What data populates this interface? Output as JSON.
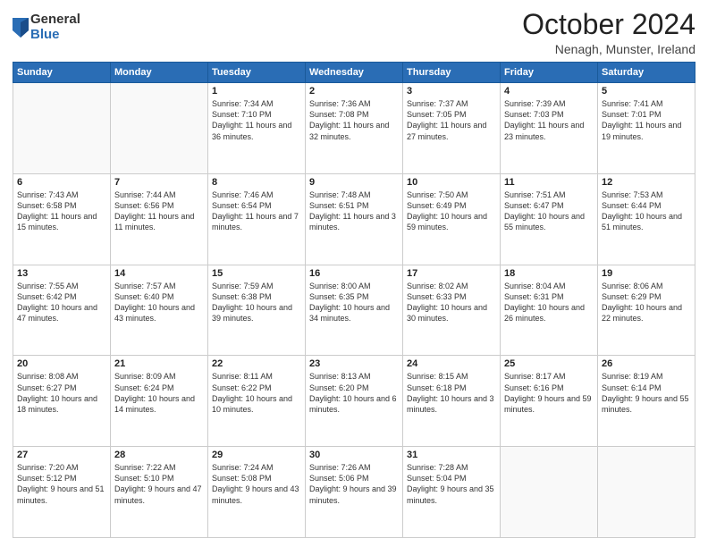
{
  "logo": {
    "general": "General",
    "blue": "Blue"
  },
  "header": {
    "month": "October 2024",
    "location": "Nenagh, Munster, Ireland"
  },
  "weekdays": [
    "Sunday",
    "Monday",
    "Tuesday",
    "Wednesday",
    "Thursday",
    "Friday",
    "Saturday"
  ],
  "weeks": [
    [
      {
        "day": "",
        "info": ""
      },
      {
        "day": "",
        "info": ""
      },
      {
        "day": "1",
        "info": "Sunrise: 7:34 AM\nSunset: 7:10 PM\nDaylight: 11 hours and 36 minutes."
      },
      {
        "day": "2",
        "info": "Sunrise: 7:36 AM\nSunset: 7:08 PM\nDaylight: 11 hours and 32 minutes."
      },
      {
        "day": "3",
        "info": "Sunrise: 7:37 AM\nSunset: 7:05 PM\nDaylight: 11 hours and 27 minutes."
      },
      {
        "day": "4",
        "info": "Sunrise: 7:39 AM\nSunset: 7:03 PM\nDaylight: 11 hours and 23 minutes."
      },
      {
        "day": "5",
        "info": "Sunrise: 7:41 AM\nSunset: 7:01 PM\nDaylight: 11 hours and 19 minutes."
      }
    ],
    [
      {
        "day": "6",
        "info": "Sunrise: 7:43 AM\nSunset: 6:58 PM\nDaylight: 11 hours and 15 minutes."
      },
      {
        "day": "7",
        "info": "Sunrise: 7:44 AM\nSunset: 6:56 PM\nDaylight: 11 hours and 11 minutes."
      },
      {
        "day": "8",
        "info": "Sunrise: 7:46 AM\nSunset: 6:54 PM\nDaylight: 11 hours and 7 minutes."
      },
      {
        "day": "9",
        "info": "Sunrise: 7:48 AM\nSunset: 6:51 PM\nDaylight: 11 hours and 3 minutes."
      },
      {
        "day": "10",
        "info": "Sunrise: 7:50 AM\nSunset: 6:49 PM\nDaylight: 10 hours and 59 minutes."
      },
      {
        "day": "11",
        "info": "Sunrise: 7:51 AM\nSunset: 6:47 PM\nDaylight: 10 hours and 55 minutes."
      },
      {
        "day": "12",
        "info": "Sunrise: 7:53 AM\nSunset: 6:44 PM\nDaylight: 10 hours and 51 minutes."
      }
    ],
    [
      {
        "day": "13",
        "info": "Sunrise: 7:55 AM\nSunset: 6:42 PM\nDaylight: 10 hours and 47 minutes."
      },
      {
        "day": "14",
        "info": "Sunrise: 7:57 AM\nSunset: 6:40 PM\nDaylight: 10 hours and 43 minutes."
      },
      {
        "day": "15",
        "info": "Sunrise: 7:59 AM\nSunset: 6:38 PM\nDaylight: 10 hours and 39 minutes."
      },
      {
        "day": "16",
        "info": "Sunrise: 8:00 AM\nSunset: 6:35 PM\nDaylight: 10 hours and 34 minutes."
      },
      {
        "day": "17",
        "info": "Sunrise: 8:02 AM\nSunset: 6:33 PM\nDaylight: 10 hours and 30 minutes."
      },
      {
        "day": "18",
        "info": "Sunrise: 8:04 AM\nSunset: 6:31 PM\nDaylight: 10 hours and 26 minutes."
      },
      {
        "day": "19",
        "info": "Sunrise: 8:06 AM\nSunset: 6:29 PM\nDaylight: 10 hours and 22 minutes."
      }
    ],
    [
      {
        "day": "20",
        "info": "Sunrise: 8:08 AM\nSunset: 6:27 PM\nDaylight: 10 hours and 18 minutes."
      },
      {
        "day": "21",
        "info": "Sunrise: 8:09 AM\nSunset: 6:24 PM\nDaylight: 10 hours and 14 minutes."
      },
      {
        "day": "22",
        "info": "Sunrise: 8:11 AM\nSunset: 6:22 PM\nDaylight: 10 hours and 10 minutes."
      },
      {
        "day": "23",
        "info": "Sunrise: 8:13 AM\nSunset: 6:20 PM\nDaylight: 10 hours and 6 minutes."
      },
      {
        "day": "24",
        "info": "Sunrise: 8:15 AM\nSunset: 6:18 PM\nDaylight: 10 hours and 3 minutes."
      },
      {
        "day": "25",
        "info": "Sunrise: 8:17 AM\nSunset: 6:16 PM\nDaylight: 9 hours and 59 minutes."
      },
      {
        "day": "26",
        "info": "Sunrise: 8:19 AM\nSunset: 6:14 PM\nDaylight: 9 hours and 55 minutes."
      }
    ],
    [
      {
        "day": "27",
        "info": "Sunrise: 7:20 AM\nSunset: 5:12 PM\nDaylight: 9 hours and 51 minutes."
      },
      {
        "day": "28",
        "info": "Sunrise: 7:22 AM\nSunset: 5:10 PM\nDaylight: 9 hours and 47 minutes."
      },
      {
        "day": "29",
        "info": "Sunrise: 7:24 AM\nSunset: 5:08 PM\nDaylight: 9 hours and 43 minutes."
      },
      {
        "day": "30",
        "info": "Sunrise: 7:26 AM\nSunset: 5:06 PM\nDaylight: 9 hours and 39 minutes."
      },
      {
        "day": "31",
        "info": "Sunrise: 7:28 AM\nSunset: 5:04 PM\nDaylight: 9 hours and 35 minutes."
      },
      {
        "day": "",
        "info": ""
      },
      {
        "day": "",
        "info": ""
      }
    ]
  ]
}
